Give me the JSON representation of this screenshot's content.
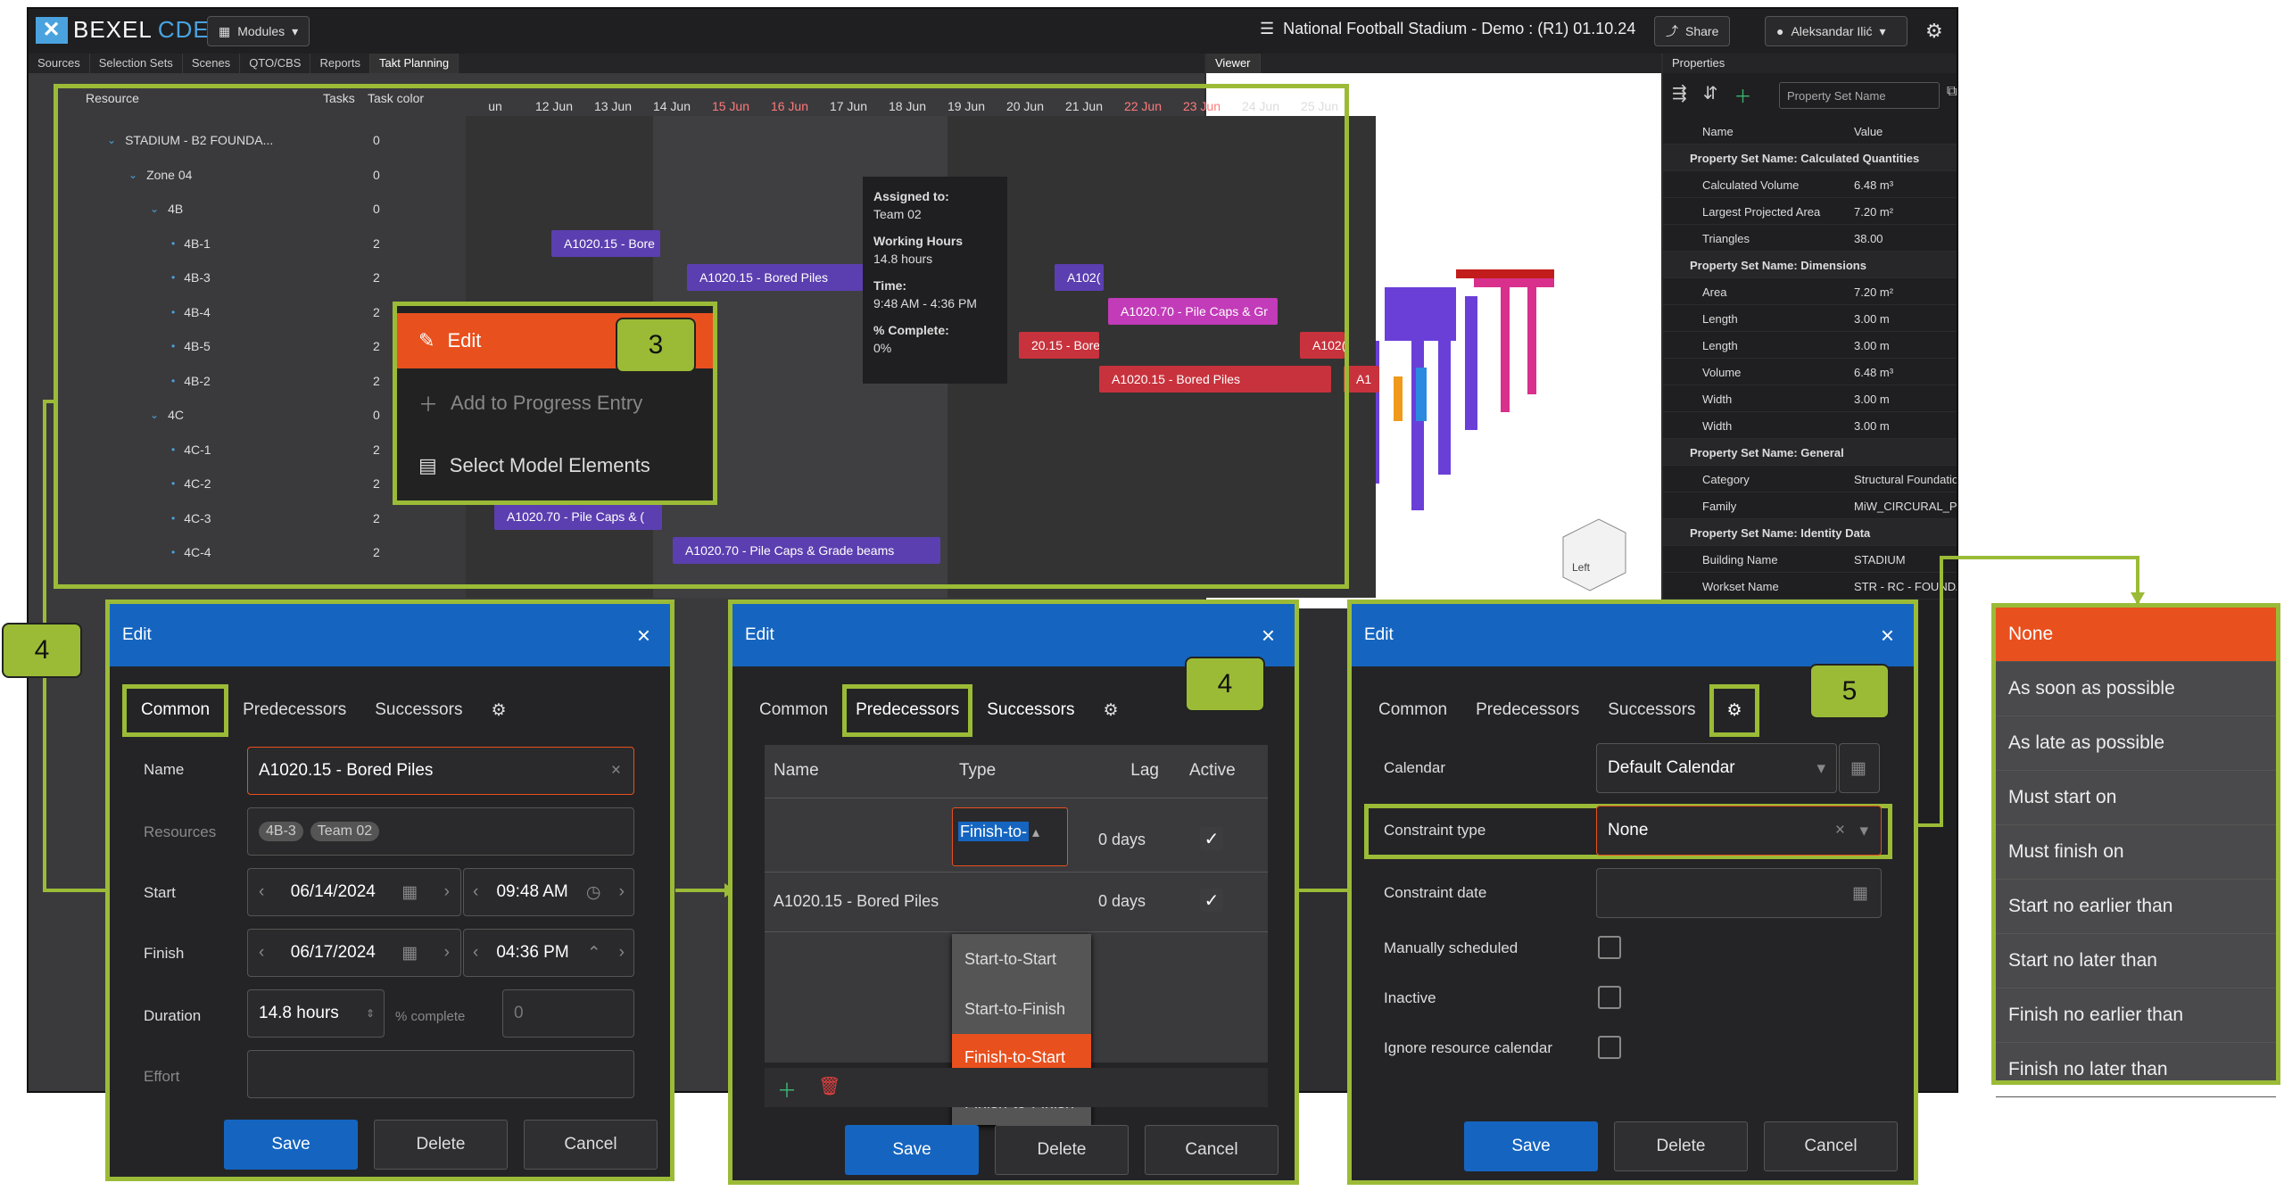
{
  "app": {
    "brand_a": "BEXEL",
    "brand_b": "CDE",
    "modules": "Modules",
    "project": "National Football Stadium - Demo : (R1) 01.10.24",
    "share": "Share",
    "user": "Aleksandar Ilić"
  },
  "tabs": [
    "Sources",
    "Selection Sets",
    "Scenes",
    "QTO/CBS",
    "Reports",
    "Takt Planning"
  ],
  "viewer_tab": "Viewer",
  "properties_tab": "Properties",
  "gantt": {
    "col_resource": "Resource",
    "col_tasks": "Tasks",
    "col_color": "Task color",
    "dates": [
      "un",
      "12 Jun",
      "13 Jun",
      "14 Jun",
      "15 Jun",
      "16 Jun",
      "17 Jun",
      "18 Jun",
      "19 Jun",
      "20 Jun",
      "21 Jun",
      "22 Jun",
      "23 Jun",
      "24 Jun",
      "25 Jun"
    ],
    "rows": [
      {
        "label": "STADIUM - B2 FOUNDA...",
        "count": "0"
      },
      {
        "label": "Zone 04",
        "count": "0"
      },
      {
        "label": "4B",
        "count": "0"
      },
      {
        "label": "4B-1",
        "count": "2"
      },
      {
        "label": "4B-3",
        "count": "2"
      },
      {
        "label": "4B-4",
        "count": "2"
      },
      {
        "label": "4B-5",
        "count": "2"
      },
      {
        "label": "4B-2",
        "count": "2"
      },
      {
        "label": "4C",
        "count": "0"
      },
      {
        "label": "4C-1",
        "count": "2"
      },
      {
        "label": "4C-2",
        "count": "2"
      },
      {
        "label": "4C-3",
        "count": "2"
      },
      {
        "label": "4C-4",
        "count": "2"
      }
    ],
    "bars": [
      "A1020.15 - Bore",
      "A1020.15 - Bored Piles",
      "A102(",
      "A1020.70 - Pile Caps & Gr",
      "20.15 - Bore",
      "A102(",
      "A1020.15 - Bored Piles",
      "A1",
      "A1020.70 - Pile Caps & (",
      "A1020.70 - Pile Caps & Grade beams"
    ]
  },
  "tooltip": {
    "assigned_label": "Assigned to:",
    "assigned": "Team 02",
    "hours_label": "Working Hours",
    "hours": "14.8 hours",
    "time_label": "Time:",
    "time": "9:48 AM - 4:36 PM",
    "complete_label": "% Complete:",
    "complete": "0%"
  },
  "context_menu": {
    "edit": "Edit",
    "add": "Add to Progress Entry",
    "select": "Select Model Elements"
  },
  "properties": {
    "search": "Property Set Name",
    "col_name": "Name",
    "col_value": "Value",
    "groups": [
      {
        "title": "Property Set Name: Calculated Quantities",
        "items": [
          [
            "Calculated Volume",
            "6.48 m³"
          ],
          [
            "Largest Projected Area",
            "7.20 m²"
          ],
          [
            "Triangles",
            "38.00"
          ]
        ]
      },
      {
        "title": "Property Set Name: Dimensions",
        "items": [
          [
            "Area",
            "7.20 m²"
          ],
          [
            "Length",
            "3.00 m"
          ],
          [
            "Length",
            "3.00 m"
          ],
          [
            "Volume",
            "6.48 m³"
          ],
          [
            "Width",
            "3.00 m"
          ],
          [
            "Width",
            "3.00 m"
          ]
        ]
      },
      {
        "title": "Property Set Name: General",
        "items": [
          [
            "Category",
            "Structural Foundations"
          ],
          [
            "Family",
            "MiW_CIRCURAL_PILE C"
          ]
        ]
      },
      {
        "title": "Property Set Name: Identity Data",
        "items": [
          [
            "Building Name",
            "STADIUM"
          ],
          [
            "Workset Name",
            "STR - RC - FOUNDATIO"
          ]
        ]
      }
    ]
  },
  "steps": {
    "a": "3",
    "b": "4",
    "c": "4",
    "d": "5"
  },
  "dlg1": {
    "title": "Edit",
    "tab_common": "Common",
    "tab_pred": "Predecessors",
    "tab_succ": "Successors",
    "name_label": "Name",
    "name": "A1020.15 - Bored Piles",
    "resources_label": "Resources",
    "res1": "4B-3",
    "res2": "Team 02",
    "start_label": "Start",
    "start_date": "06/14/2024",
    "start_time": "09:48 AM",
    "finish_label": "Finish",
    "finish_date": "06/17/2024",
    "finish_time": "04:36 PM",
    "duration_label": "Duration",
    "duration": "14.8 hours",
    "complete_label": "% complete",
    "complete": "0",
    "effort_label": "Effort",
    "save": "Save",
    "delete": "Delete",
    "cancel": "Cancel"
  },
  "dlg2": {
    "title": "Edit",
    "tab_common": "Common",
    "tab_pred": "Predecessors",
    "tab_succ": "Successors",
    "col_name": "Name",
    "col_type": "Type",
    "col_lag": "Lag",
    "col_active": "Active",
    "row1_type": "Finish-to-",
    "row1_lag": "0 days",
    "row2_name": "A1020.15 - Bored Piles",
    "row2_lag": "0 days",
    "options": [
      "Start-to-Start",
      "Start-to-Finish",
      "Finish-to-Start",
      "Finish-to-Finish"
    ],
    "save": "Save",
    "delete": "Delete",
    "cancel": "Cancel"
  },
  "dlg3": {
    "title": "Edit",
    "tab_common": "Common",
    "tab_pred": "Predecessors",
    "tab_succ": "Successors",
    "calendar_label": "Calendar",
    "calendar": "Default Calendar",
    "ctype_label": "Constraint type",
    "ctype": "None",
    "cdate_label": "Constraint date",
    "manual_label": "Manually scheduled",
    "inactive_label": "Inactive",
    "ignore_label": "Ignore resource calendar",
    "save": "Save",
    "delete": "Delete",
    "cancel": "Cancel"
  },
  "constraint_options": [
    "None",
    "As soon as possible",
    "As late as possible",
    "Must start on",
    "Must finish on",
    "Start no earlier than",
    "Start no later than",
    "Finish no earlier than",
    "Finish no later than"
  ],
  "colors": {
    "accent": "#9bbb37",
    "orange": "#e8501e",
    "blue": "#1565c0",
    "purple": "#5b3fb0",
    "magenta": "#c23bb8",
    "red": "#c8323c"
  }
}
